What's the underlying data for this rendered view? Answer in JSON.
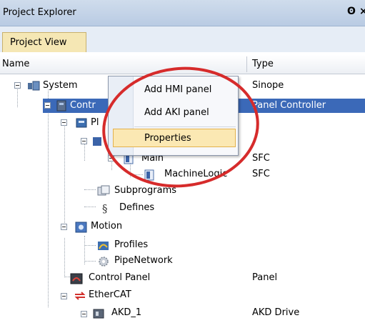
{
  "panel": {
    "title": "Project Explorer",
    "pin_glyph": "ʘ",
    "close_glyph": "×"
  },
  "tab": {
    "label": "Project View"
  },
  "columns": {
    "name": "Name",
    "type": "Type"
  },
  "tree": {
    "system": {
      "name": "System",
      "type": "Sinope"
    },
    "controller": {
      "name": "Contr",
      "type": "Panel Controller"
    },
    "plc": {
      "name": "Pl"
    },
    "main": {
      "name": "Main",
      "type": "SFC"
    },
    "machinelogic": {
      "name": "MachineLogic",
      "type": "SFC"
    },
    "subprograms": {
      "name": "Subprograms"
    },
    "defines": {
      "name": "Defines"
    },
    "motion": {
      "name": "Motion"
    },
    "profiles": {
      "name": "Profiles"
    },
    "pipenetwork": {
      "name": "PipeNetwork"
    },
    "controlpanel": {
      "name": "Control Panel",
      "type": "Panel"
    },
    "ethercat": {
      "name": "EtherCAT"
    },
    "akd1": {
      "name": "AKD_1",
      "type": "AKD Drive"
    }
  },
  "context_menu": {
    "items": [
      "Add HMI panel",
      "Add AKI panel",
      "Properties"
    ],
    "highlighted": "Properties"
  },
  "colors": {
    "selection": "#3b69b8",
    "menu_highlight": "#fbe8b3",
    "annotation": "#d62b2b"
  }
}
